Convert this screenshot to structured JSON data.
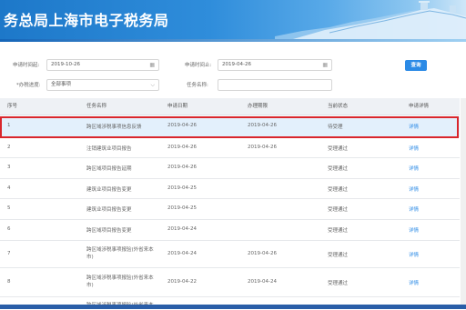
{
  "header": {
    "title": "务总局上海市电子税务局"
  },
  "filters": {
    "apply_start_label": "申请时间起:",
    "apply_start_value": "2019-10-26",
    "apply_end_label": "申请时间止:",
    "apply_end_value": "2019-04-26",
    "status_label": "*办税进度:",
    "status_value": "全部事项",
    "task_label": "任务名称:",
    "task_value": "",
    "query_label": "查询"
  },
  "table": {
    "headers": [
      "序号",
      "任务名称",
      "申请日期",
      "办理期限",
      "当前状态",
      "申请详情"
    ],
    "rows": [
      {
        "no": "1",
        "name": "跨区域涉税事项信息反馈",
        "apply": "2019-04-26",
        "deadline": "2019-04-26",
        "status": "待受理",
        "detail": "详情"
      },
      {
        "no": "2",
        "name": "注销建筑业项目报告",
        "apply": "2019-04-26",
        "deadline": "2019-04-26",
        "status": "受理通过",
        "detail": "详情"
      },
      {
        "no": "3",
        "name": "跨区域项目报告延期",
        "apply": "2019-04-26",
        "deadline": "",
        "status": "受理通过",
        "detail": "详情"
      },
      {
        "no": "4",
        "name": "建筑业项目报告变更",
        "apply": "2019-04-25",
        "deadline": "",
        "status": "受理通过",
        "detail": "详情"
      },
      {
        "no": "5",
        "name": "建筑业项目报告变更",
        "apply": "2019-04-25",
        "deadline": "",
        "status": "受理通过",
        "detail": "详情"
      },
      {
        "no": "6",
        "name": "跨区域项目报告变更",
        "apply": "2019-04-24",
        "deadline": "",
        "status": "受理通过",
        "detail": "详情"
      },
      {
        "no": "7",
        "name": "跨区域涉税事项报验(外省来本市)",
        "apply": "2019-04-24",
        "deadline": "2019-04-26",
        "status": "受理通过",
        "detail": "详情"
      },
      {
        "no": "8",
        "name": "跨区域涉税事项报验(外省来本市)",
        "apply": "2019-04-22",
        "deadline": "2019-04-24",
        "status": "受理通过",
        "detail": "详情"
      },
      {
        "no": "",
        "name": "跨区域涉税事项报验(外省来本",
        "apply": "",
        "deadline": "",
        "status": "",
        "detail": ""
      }
    ]
  },
  "colors": {
    "banner": "#2f8ddb",
    "link": "#2b8ae6",
    "highlight": "#e3f0fc",
    "outline": "#d9262c"
  }
}
